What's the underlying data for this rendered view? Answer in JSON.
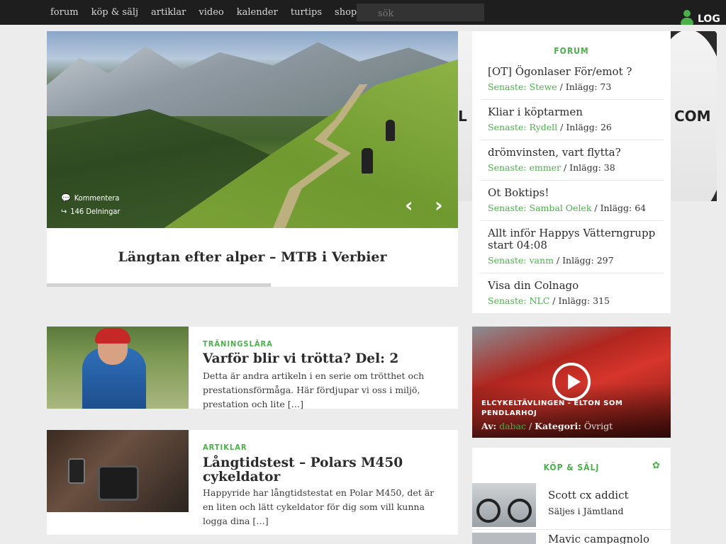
{
  "nav": {
    "items": [
      "forum",
      "köp & sälj",
      "artiklar",
      "video",
      "kalender",
      "turtips",
      "shop"
    ],
    "search_placeholder": "sök",
    "login_label": "LOG"
  },
  "hero": {
    "comment_label": "Kommentera",
    "shares_label": "146 Delningar",
    "title": "Längtan efter alper – MTB i Verbier",
    "slide_progress": 0.545
  },
  "ad": {
    "text_left": "L",
    "text_right": "COM"
  },
  "forum": {
    "header": "FORUM",
    "threads": [
      {
        "title": "[OT] Ögonlaser För/emot ?",
        "latest_label": "Senaste:",
        "user": "Stewe",
        "posts_label": "Inlägg:",
        "posts": "73"
      },
      {
        "title": "Kliar i köptarmen",
        "latest_label": "Senaste:",
        "user": "Rydell",
        "posts_label": "Inlägg:",
        "posts": "26"
      },
      {
        "title": "drömvinsten, vart flytta?",
        "latest_label": "Senaste:",
        "user": "emmer",
        "posts_label": "Inlägg:",
        "posts": "38"
      },
      {
        "title": "Ot Boktips!",
        "latest_label": "Senaste:",
        "user": "Sambal Oelek",
        "posts_label": "Inlägg:",
        "posts": "64"
      },
      {
        "title": "Allt inför Happys Vätterngrupp start 04:08",
        "latest_label": "Senaste:",
        "user": "vanm",
        "posts_label": "Inlägg:",
        "posts": "297"
      },
      {
        "title": "Visa din Colnago",
        "latest_label": "Senaste:",
        "user": "NLC",
        "posts_label": "Inlägg:",
        "posts": "315"
      }
    ]
  },
  "articles": [
    {
      "category": "TRÄNINGSLÄRA",
      "title": "Varför blir vi trötta? Del: 2",
      "excerpt": "Detta är andra artikeln i en serie om trötthet och prestationsförmåga. Här fördjupar vi oss i miljö, prestation och lite […]"
    },
    {
      "category": "ARTIKLAR",
      "title": "Långtidstest – Polars M450 cykeldator",
      "excerpt": "Happyride har långtidstestat en Polar M450, det är en liten och lätt cykeldator för dig som vill kunna logga dina […]"
    }
  ],
  "video": {
    "title": "ELCYKELTÄVLINGEN - ELTON SOM PENDLARHOJ",
    "by_label": "Av:",
    "author": "dabac",
    "category_label": "Kategori:",
    "category": "Övrigt"
  },
  "kop": {
    "header": "KÖP & SÄLJ",
    "items": [
      {
        "title": "Scott cx addict",
        "sub": "Säljes i Jämtland"
      },
      {
        "title": "Mavic campagnolo",
        "sub": ""
      }
    ]
  },
  "colors": {
    "accent": "#4ab04a",
    "nav_bg": "#1e1e1e",
    "page_bg": "#ececec"
  }
}
